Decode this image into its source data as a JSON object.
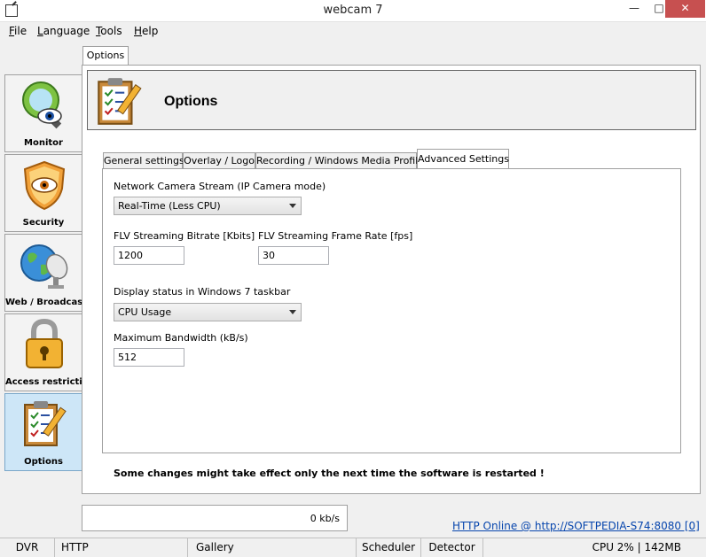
{
  "window": {
    "title": "webcam 7",
    "min": "—",
    "max": "□",
    "close": "✕"
  },
  "menu": [
    {
      "u": "F",
      "rest": "ile"
    },
    {
      "u": "L",
      "rest": "anguage"
    },
    {
      "u": "T",
      "rest": "ools"
    },
    {
      "u": "H",
      "rest": "elp"
    }
  ],
  "sidebar": {
    "items": [
      {
        "label": "Monitor",
        "icon": "monitor-eye-icon"
      },
      {
        "label": "Security",
        "icon": "shield-eye-icon"
      },
      {
        "label": "Web / Broadcast",
        "icon": "globe-dish-icon"
      },
      {
        "label": "Access restriction",
        "icon": "padlock-icon"
      },
      {
        "label": "Options",
        "icon": "clipboard-checklist-icon"
      }
    ]
  },
  "outer_tab": "Options",
  "header": {
    "title": "Options"
  },
  "tabs": [
    "General settings",
    "Overlay / Logo",
    "Recording / Windows Media Profiles",
    "Advanced Settings"
  ],
  "fields": {
    "stream_label": "Network Camera Stream (IP Camera mode)",
    "stream_value": "Real-Time (Less CPU)",
    "bitrate_label": "FLV Streaming Bitrate [Kbits]",
    "bitrate_value": "1200",
    "framerate_label": "FLV Streaming Frame Rate  [fps]",
    "framerate_value": "30",
    "taskbar_label": "Display status in Windows 7 taskbar",
    "taskbar_value": "CPU Usage",
    "bandwidth_label": "Maximum Bandwidth (kB/s)",
    "bandwidth_value": "512"
  },
  "notice": "Some changes might take effect only the next time the software is restarted !",
  "throughput": "0 kb/s",
  "http_status": "HTTP Online @ http://SOFTPEDIA-S74:8080 [0]",
  "statusbar": {
    "dvr": "DVR",
    "http": "HTTP",
    "gallery": "Gallery",
    "scheduler": "Scheduler",
    "detector": "Detector",
    "cpu": "CPU 2% | 142MB"
  }
}
